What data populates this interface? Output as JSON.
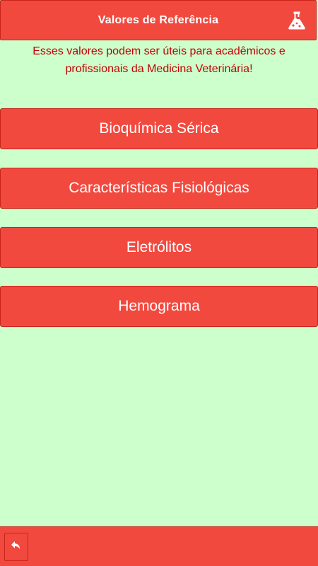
{
  "header": {
    "title": "Valores de Referência",
    "icon": "lab-flask-icon"
  },
  "intro": {
    "text": "Esses valores podem ser úteis para acadêmicos e profissionais da Medicina Veterinária!"
  },
  "menu": {
    "items": [
      {
        "label": "Bioquímica Sérica"
      },
      {
        "label": "Características Fisiológicas"
      },
      {
        "label": "Eletrólitos"
      },
      {
        "label": "Hemograma"
      }
    ]
  },
  "footer": {
    "back_icon": "back-arrow-icon"
  },
  "colors": {
    "background": "#ccffcc",
    "accent": "#f2493f",
    "accent_border": "#c8251c",
    "intro_text": "#c40000"
  }
}
